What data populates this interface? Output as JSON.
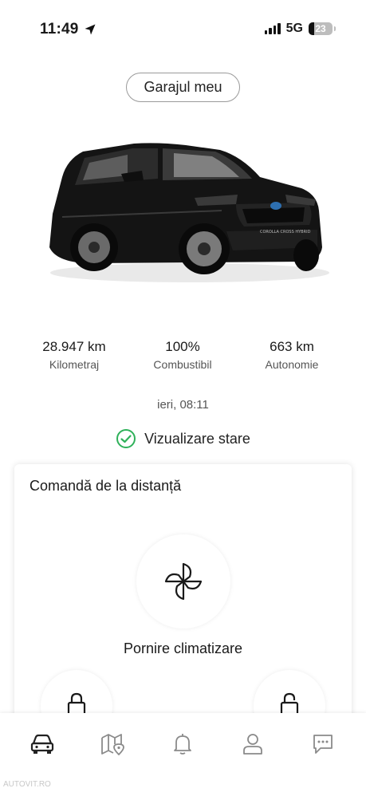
{
  "status_bar": {
    "time": "11:49",
    "network": "5G",
    "battery": "23"
  },
  "garage_button": "Garajul meu",
  "stats": [
    {
      "value": "28.947 km",
      "label": "Kilometraj"
    },
    {
      "value": "100%",
      "label": "Combustibil"
    },
    {
      "value": "663 km",
      "label": "Autonomie"
    }
  ],
  "last_update": "ieri, 08:11",
  "status_link": "Vizualizare stare",
  "remote": {
    "title": "Comandă de la distanță",
    "climate_label": "Pornire climatizare"
  },
  "car_badge": "COROLLA CROSS HYBRID",
  "nav": [
    "car-icon",
    "map-icon",
    "bell-icon",
    "profile-icon",
    "chat-icon"
  ],
  "watermark": "AUTOVIT.RO",
  "colors": {
    "check": "#2fb15a",
    "nav_active": "#222222",
    "nav_inactive": "#8a8a8a"
  }
}
